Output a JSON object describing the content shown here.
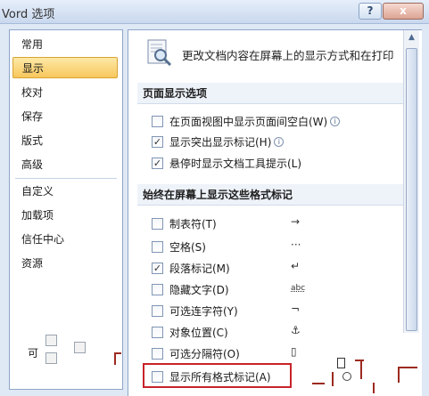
{
  "window": {
    "title": "Vord 选项",
    "help_label": "?",
    "close_label": "x"
  },
  "nav": {
    "items": [
      {
        "label": "常用"
      },
      {
        "label": "显示"
      },
      {
        "label": "校对"
      },
      {
        "label": "保存"
      },
      {
        "label": "版式"
      },
      {
        "label": "高级"
      },
      {
        "label": "自定义"
      },
      {
        "label": "加载项"
      },
      {
        "label": "信任中心"
      },
      {
        "label": "资源"
      }
    ],
    "selected": "显示",
    "footer_fragment": "可"
  },
  "header": {
    "text": "更改文档内容在屏幕上的显示方式和在打印",
    "icon": "magnifier-document-icon"
  },
  "sections": [
    {
      "title": "页面显示选项",
      "options": [
        {
          "label": "在页面视图中显示页面间空白(W)",
          "checked": false,
          "info": true
        },
        {
          "label": "显示突出显示标记(H)",
          "checked": true,
          "info": true
        },
        {
          "label": "悬停时显示文档工具提示(L)",
          "checked": true,
          "info": false
        }
      ]
    },
    {
      "title": "始终在屏幕上显示这些格式标记",
      "options": [
        {
          "label": "制表符(T)",
          "checked": false,
          "symbol": "→"
        },
        {
          "label": "空格(S)",
          "checked": false,
          "symbol": "···"
        },
        {
          "label": "段落标记(M)",
          "checked": true,
          "symbol": "↵"
        },
        {
          "label": "隐藏文字(D)",
          "checked": false,
          "symbol": "abc"
        },
        {
          "label": "可选连字符(Y)",
          "checked": false,
          "symbol": "¬"
        },
        {
          "label": "对象位置(C)",
          "checked": false,
          "symbol": "⚓"
        },
        {
          "label": "可选分隔符(O)",
          "checked": false,
          "symbol": "▯"
        },
        {
          "label": "显示所有格式标记(A)",
          "checked": false,
          "symbol": ""
        }
      ]
    }
  ],
  "checkmark": "✓",
  "info_glyph": "i",
  "colors": {
    "selected_nav": "#f8c75d",
    "highlight_border": "#c8232a",
    "dialog_bg": "#dfe8f5"
  }
}
